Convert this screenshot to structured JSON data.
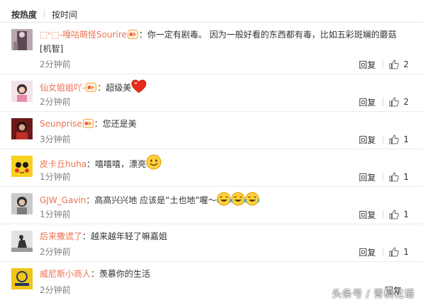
{
  "tabs": {
    "hot": "按热度",
    "time": "按时间"
  },
  "comments": [
    {
      "user": "⬚ᵛ⬚-嘎咕萌怪Sourire",
      "text": "：你一定有剧毒。 因为一般好看的东西都有毒，比如五彩斑斓的蘑菇[机智]",
      "time": "2分钟前",
      "reply": "回复",
      "likes": "2"
    },
    {
      "user": "仙女姐姐吖-",
      "text": "：超级美",
      "time": "2分钟前",
      "reply": "回复",
      "likes": "2"
    },
    {
      "user": "Seunprise",
      "text": "：您还是美",
      "time": "3分钟前",
      "reply": "回复",
      "likes": "1"
    },
    {
      "user": "皮卡丘huha",
      "text": "：嘻嘻嘻，漂亮",
      "time": "1分钟前",
      "reply": "回复",
      "likes": "1"
    },
    {
      "user": "GJW_Gavin",
      "text": "：高高兴兴地 应该是“土也地”喔～",
      "time": "1分钟前",
      "reply": "回复",
      "likes": "1"
    },
    {
      "user": "后来撒谎了",
      "text": "：越来越年轻了嘛嘉姐",
      "time": "2分钟前",
      "reply": "回复",
      "likes": "1"
    },
    {
      "user": "威尼斯小商人",
      "text": "：羡慕你的生活",
      "time": "2分钟前",
      "reply": "回复",
      "likes": ""
    }
  ],
  "watermark": "头条号 / 青桐花语",
  "colors": {
    "username": "#eb7350",
    "time": "#808080"
  }
}
